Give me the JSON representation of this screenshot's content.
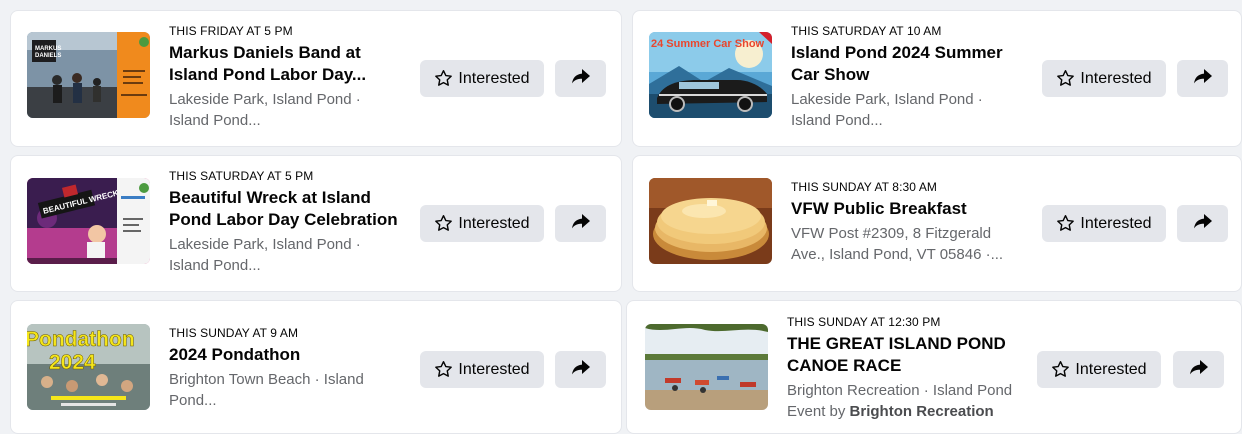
{
  "interested_label": "Interested",
  "by_prefix": "Event by",
  "events": [
    {
      "when": "THIS FRIDAY AT 5 PM",
      "title": [
        "Markus Daniels Band at",
        "Island Pond Labor Day..."
      ],
      "location": [
        "Lakeside Park, Island Pond ·",
        "Island Pond..."
      ],
      "thumb": "band-stage-photo"
    },
    {
      "when": "THIS SATURDAY AT 10 AM",
      "title": [
        "Island Pond 2024 Summer",
        "Car Show"
      ],
      "location": [
        "Lakeside Park, Island Pond ·",
        "Island Pond..."
      ],
      "thumb": "classic-car-poster",
      "thumb_text": "24 Summer Car Show"
    },
    {
      "when": "THIS SATURDAY AT 5 PM",
      "title": [
        "Beautiful Wreck at Island",
        "Pond Labor Day Celebration"
      ],
      "location": [
        "Lakeside Park, Island Pond ·",
        "Island Pond..."
      ],
      "thumb": "band-poster",
      "thumb_text": "BEAUTIFUL WRECK"
    },
    {
      "when": "THIS SUNDAY AT 8:30 AM",
      "title": [
        "VFW Public Breakfast"
      ],
      "location": [
        "VFW Post #2309, 8 Fitzgerald",
        "Ave., Island Pond, VT 05846 ·..."
      ],
      "thumb": "pancakes-photo"
    },
    {
      "when": "THIS SUNDAY AT 9 AM",
      "title": [
        "2024 Pondathon"
      ],
      "location": [
        "Brighton Town Beach · Island",
        "Pond..."
      ],
      "thumb": "pondathon-poster",
      "thumb_text": [
        "Pondathon",
        "2024"
      ]
    },
    {
      "when": "THIS SUNDAY AT 12:30 PM",
      "title": [
        "THE GREAT ISLAND POND",
        "CANOE RACE"
      ],
      "location": [
        "Brighton Recreation · Island Pond"
      ],
      "host": "Brighton Recreation",
      "thumb": "canoe-lake-photo"
    }
  ],
  "colors": {
    "page_bg": "#f0f2f5",
    "card_bg": "#ffffff",
    "button_bg": "#e4e6eb",
    "secondary_text": "#65676b"
  },
  "icons": {
    "interested": "star-outline-icon",
    "share": "share-arrow-icon"
  }
}
